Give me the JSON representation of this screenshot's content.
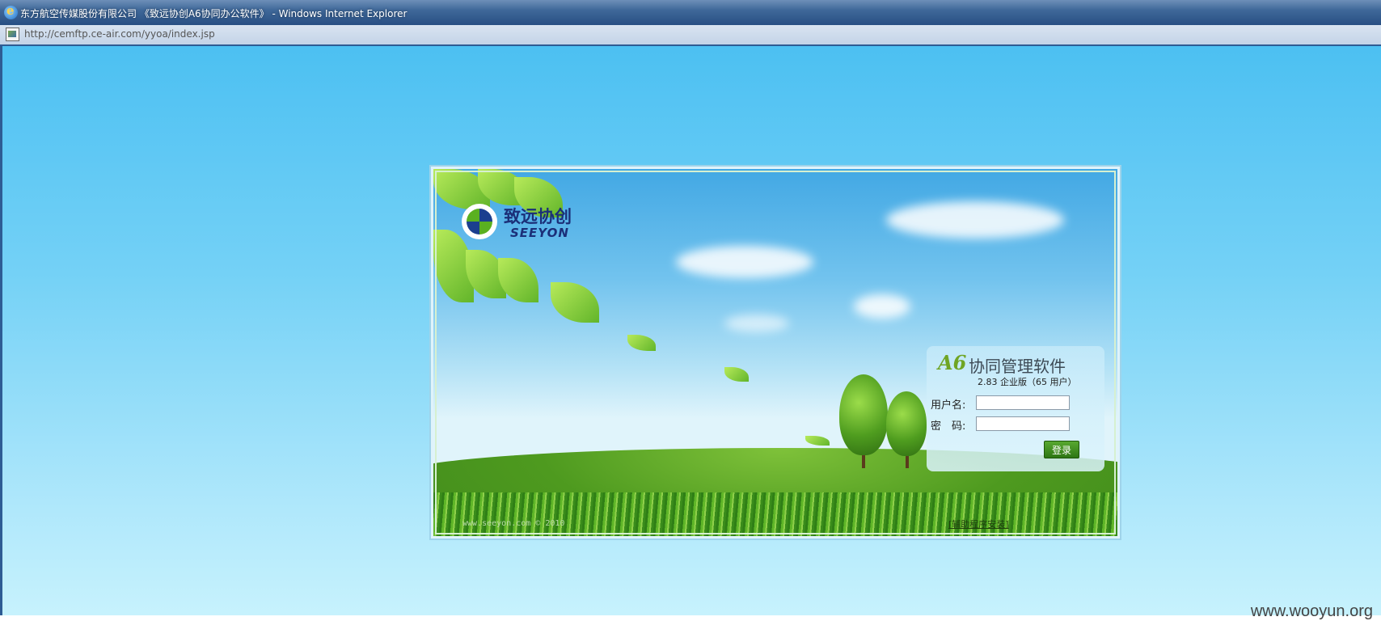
{
  "window": {
    "title": "东方航空传媒股份有限公司 《致远协创A6协同办公软件》 - Windows Internet Explorer",
    "url": "http://cemftp.ce-air.com/yyoa/index.jsp"
  },
  "brand": {
    "name_cn": "致远协创",
    "name_en": "SEEYON"
  },
  "login": {
    "logo_mark": "A6",
    "product_name": "协同管理软件",
    "version": "2.83 企业版（65 用户）",
    "username_label": "用户名:",
    "password_label": "密　码:",
    "username_value": "",
    "password_value": "",
    "submit_label": "登录"
  },
  "footer": {
    "copyright": "www.seeyon.com © 2010",
    "helper_link": "[辅助程序安装]"
  },
  "watermark": "www.wooyun.org",
  "colors": {
    "accent_green": "#2d7614",
    "brand_blue": "#1b2f78",
    "sky": "#4cc0f2"
  }
}
